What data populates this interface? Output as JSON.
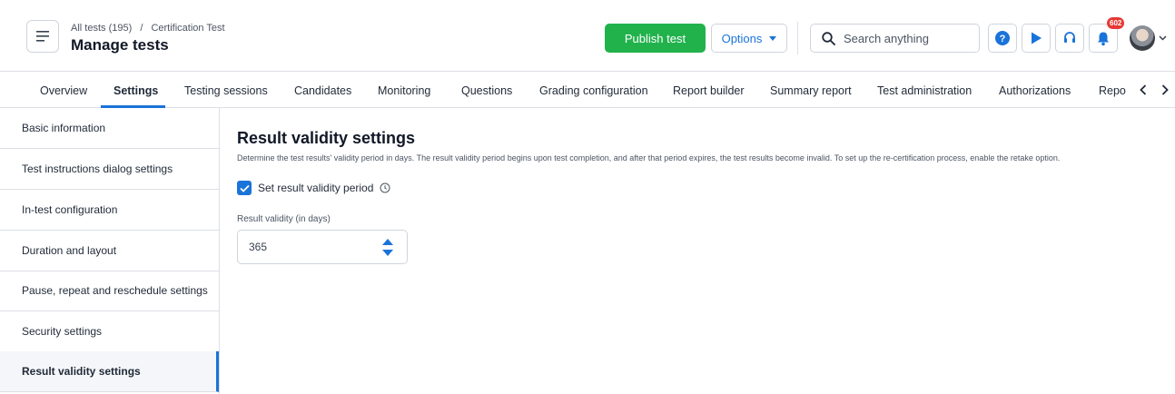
{
  "breadcrumb": {
    "parent": "All tests (195)",
    "separator": "/",
    "current": "Certification Test"
  },
  "header": {
    "title": "Manage tests",
    "publish_label": "Publish test",
    "options_label": "Options",
    "search_placeholder": "Search anything",
    "notifications_count": "602"
  },
  "tabs": [
    {
      "label": "Overview"
    },
    {
      "label": "Settings",
      "active": true
    },
    {
      "label": "Testing sessions"
    },
    {
      "label": "Candidates"
    },
    {
      "label": "Monitoring"
    },
    {
      "label": "Questions"
    },
    {
      "label": "Grading configuration"
    },
    {
      "label": "Report builder"
    },
    {
      "label": "Summary report"
    },
    {
      "label": "Test administration"
    },
    {
      "label": "Authorizations"
    },
    {
      "label": "Reports"
    }
  ],
  "sidebar": {
    "items": [
      {
        "label": "Basic information"
      },
      {
        "label": "Test instructions dialog settings"
      },
      {
        "label": "In-test configuration"
      },
      {
        "label": "Duration and layout"
      },
      {
        "label": "Pause, repeat and reschedule settings"
      },
      {
        "label": "Security settings"
      },
      {
        "label": "Result validity settings",
        "active": true
      }
    ]
  },
  "main": {
    "title": "Result validity settings",
    "description": "Determine the test results' validity period in days. The result validity period begins upon test completion, and after that period expires, the test results become invalid. To set up the re-certification process, enable the retake option.",
    "checkbox_label": "Set result validity period",
    "checkbox_checked": true,
    "field_label": "Result validity (in days)",
    "field_value": "365"
  },
  "colors": {
    "accent": "#1a73d9",
    "publish": "#22b24c",
    "badge": "#e53935"
  },
  "icons": {
    "menu": "menu-icon",
    "search": "search-icon",
    "help": "help-icon",
    "play": "play-icon",
    "support": "headset-icon",
    "notifications": "bell-icon",
    "info": "info-icon"
  }
}
